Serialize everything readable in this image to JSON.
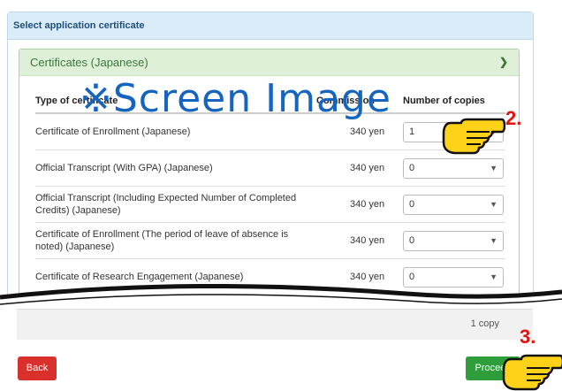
{
  "outer": {
    "title": "Select application certificate"
  },
  "accordion": {
    "title": "Certificates (Japanese)",
    "toggle_icon": "chevron-down-icon"
  },
  "table": {
    "headers": {
      "type": "Type of certificate",
      "fee": "Commission",
      "copies": "Number of copies"
    },
    "rows": [
      {
        "name": "Certificate of Enrollment (Japanese)",
        "fee": "340 yen",
        "copies": "1"
      },
      {
        "name": "Official Transcript (With GPA) (Japanese)",
        "fee": "340 yen",
        "copies": "0"
      },
      {
        "name": "Official Transcript (Including Expected Number of Completed Credits) (Japanese)",
        "fee": "340 yen",
        "copies": "0"
      },
      {
        "name": "Certificate of Enrollment (The period of leave of absence is noted) (Japanese)",
        "fee": "340 yen",
        "copies": "0"
      },
      {
        "name": "Certificate of Research Engagement (Japanese)",
        "fee": "340 yen",
        "copies": "0"
      }
    ]
  },
  "summary": {
    "total": "1 copy"
  },
  "buttons": {
    "back": "Back",
    "proceed": "Proceed"
  },
  "annotations": {
    "watermark": "※Screen Image",
    "step2": "2.",
    "step3": "3."
  },
  "colors": {
    "back": "#d9302c",
    "proceed": "#2e9e3b",
    "annotation": "#e0140c",
    "watermark": "#1565c0"
  }
}
